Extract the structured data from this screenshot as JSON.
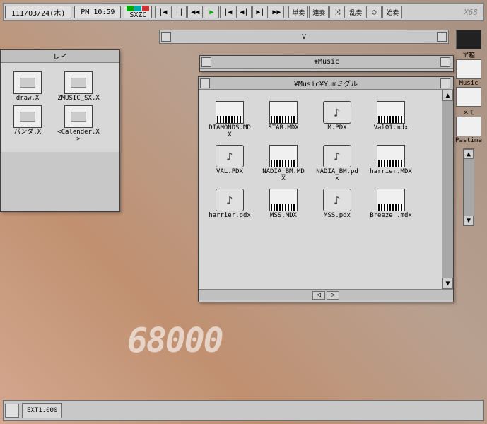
{
  "menubar": {
    "date": "111/03/24(木)",
    "clock_prefix": "PM",
    "clock_time": "10:59",
    "sxzc": "SXZC",
    "transport_labels": {
      "tan": "単奏",
      "ren": "連奏",
      "ran": "乱奏",
      "shi": "始奏"
    },
    "logo": "X68"
  },
  "bar2": {
    "title": "V"
  },
  "win1": {
    "title": "レイ",
    "files": [
      {
        "name": "draw.X",
        "type": "sys"
      },
      {
        "name": "ZMUSIC_SX.X",
        "type": "sys"
      },
      {
        "name": "パンダ.X",
        "type": "sys"
      },
      {
        "name": "<Calender.X>",
        "type": "sys"
      }
    ]
  },
  "win2": {
    "title": "¥Music"
  },
  "win3": {
    "title": "¥Music¥Yumミグル",
    "files": [
      {
        "name": "DIAMONDS.MDX",
        "type": "mdx"
      },
      {
        "name": "STAR.MDX",
        "type": "mdx"
      },
      {
        "name": "M.PDX",
        "type": "pdx"
      },
      {
        "name": "Val01.mdx",
        "type": "mdx"
      },
      {
        "name": "VAL.PDX",
        "type": "pdx"
      },
      {
        "name": "NADIA_BM.MDX",
        "type": "mdx"
      },
      {
        "name": "NADIA_BM.pdx",
        "type": "pdx"
      },
      {
        "name": "harrier.MDX",
        "type": "mdx"
      },
      {
        "name": "harrier.pdx",
        "type": "pdx"
      },
      {
        "name": "MSS.MDX",
        "type": "mdx"
      },
      {
        "name": "MSS.pdx",
        "type": "pdx"
      },
      {
        "name": "Breeze_.mdx",
        "type": "mdx"
      }
    ]
  },
  "sidebar": {
    "items": [
      {
        "label": "ヹ゙゙箱",
        "type": "dark"
      },
      {
        "label": "Music",
        "type": "light"
      },
      {
        "label": "メモ",
        "type": "light"
      },
      {
        "label": "Pastime",
        "type": "light"
      }
    ]
  },
  "taskbar": {
    "item1": "EXT1.000"
  },
  "wallpaper": "68000"
}
